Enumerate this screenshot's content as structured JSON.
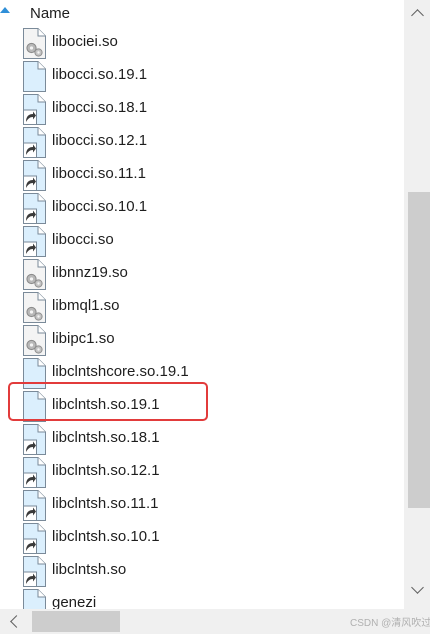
{
  "header": {
    "column_label": "Name",
    "sort_icon": "sort-ascending-icon"
  },
  "files": [
    {
      "name": "libociei.so",
      "icon": "settings-file-icon"
    },
    {
      "name": "libocci.so.19.1",
      "icon": "blank-file-icon"
    },
    {
      "name": "libocci.so.18.1",
      "icon": "shortcut-file-icon"
    },
    {
      "name": "libocci.so.12.1",
      "icon": "shortcut-file-icon"
    },
    {
      "name": "libocci.so.11.1",
      "icon": "shortcut-file-icon"
    },
    {
      "name": "libocci.so.10.1",
      "icon": "shortcut-file-icon"
    },
    {
      "name": "libocci.so",
      "icon": "shortcut-file-icon"
    },
    {
      "name": "libnnz19.so",
      "icon": "settings-file-icon"
    },
    {
      "name": "libmql1.so",
      "icon": "settings-file-icon"
    },
    {
      "name": "libipc1.so",
      "icon": "settings-file-icon"
    },
    {
      "name": "libclntshcore.so.19.1",
      "icon": "blank-file-icon"
    },
    {
      "name": "libclntsh.so.19.1",
      "icon": "blank-file-icon",
      "highlighted": true
    },
    {
      "name": "libclntsh.so.18.1",
      "icon": "shortcut-file-icon"
    },
    {
      "name": "libclntsh.so.12.1",
      "icon": "shortcut-file-icon"
    },
    {
      "name": "libclntsh.so.11.1",
      "icon": "shortcut-file-icon"
    },
    {
      "name": "libclntsh.so.10.1",
      "icon": "shortcut-file-icon"
    },
    {
      "name": "libclntsh.so",
      "icon": "shortcut-file-icon"
    },
    {
      "name": "genezi",
      "icon": "blank-file-icon"
    }
  ],
  "colors": {
    "highlight_border": "#e23b3b",
    "file_page": "#dbeffd",
    "shortcut_arrow": "#3a3a3a",
    "sort_arrow": "#2f8fd8"
  },
  "watermark": "CSDN @清风吹过"
}
